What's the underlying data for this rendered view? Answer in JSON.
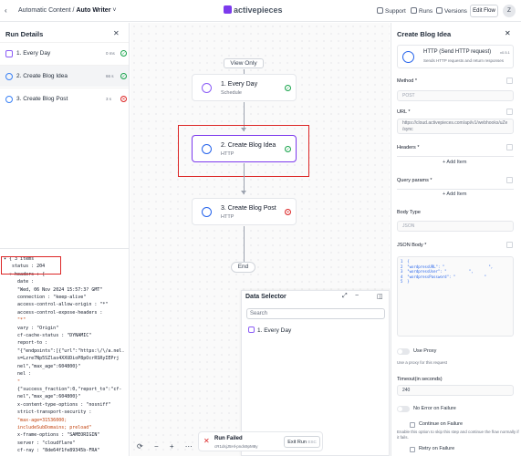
{
  "topbar": {
    "back_icon": "back-arrow",
    "breadcrumb_prefix": "Automatic Content /",
    "breadcrumb_flow": "Auto Writer",
    "brand": "activepieces",
    "support": "Support",
    "runs": "Runs",
    "versions": "Versions",
    "edit_flow": "Edit Flow",
    "avatar": "Z"
  },
  "run_details": {
    "title": "Run Details",
    "steps": [
      {
        "label": "1. Every Day",
        "time": "0 ms",
        "status": "success"
      },
      {
        "label": "2. Create Blog Idea",
        "time": "66 s",
        "status": "success"
      },
      {
        "label": "3. Create Blog Post",
        "time": "3 s",
        "status": "failed"
      }
    ],
    "output_lines": [
      "▾ { 3 items",
      "   status : 204",
      "  ▾ headers : {",
      "     date :",
      "     \"Wed, 06 Nov 2024 15:57:3? GMT\"",
      "     connection : \"keep-alive\"",
      "     access-control-allow-origin : \"*\"",
      "     access-control-expose-headers :",
      "     \"*\"",
      "     vary : \"Origin\"",
      "     cf-cache-status : \"DYNAMIC\"",
      "     report-to :",
      "     \"{\"endpoints\":[{\"url\":\"https:\\/\\/a.nel.",
      "     s=Lzre7Np5SZlas4XXUDioP8pOcrRSRyIEPrj",
      "     nel\",\"max_age\":604800}\"",
      "     nel :",
      "     \"",
      "     {\"success_fraction\":0,\"report_to\":\"cf-",
      "     nel\",\"max_age\":604800}\"",
      "     x-content-type-options : \"nosniff\"",
      "     strict-transport-security :",
      "     \"max-age=31536000;",
      "     includeSubDomains; preload\"",
      "     x-frame-options : \"SAMEORIGIN\"",
      "     server : \"cloudflare\"",
      "     cf-ray : \"8de64f1fe89345b-FRA\""
    ]
  },
  "canvas": {
    "view_only": "View Only",
    "nodes": [
      {
        "title": "1. Every Day",
        "subtitle": "Schedule",
        "status": "success"
      },
      {
        "title": "2. Create Blog Idea",
        "subtitle": "HTTP",
        "status": "success"
      },
      {
        "title": "3. Create Blog Post",
        "subtitle": "HTTP",
        "status": "failed"
      }
    ],
    "end": "End",
    "controls": [
      "⟳",
      "−",
      "+",
      "⋯"
    ]
  },
  "toast": {
    "title": "Run Failed",
    "subtitle": "cR1dsjJ5Hl-pnds9pM8y",
    "exit": "Exit Run",
    "esc": "ESC"
  },
  "data_selector": {
    "title": "Data Selector",
    "search_placeholder": "Search",
    "items": [
      "1. Every Day"
    ]
  },
  "step_settings": {
    "title": "Create Blog Idea",
    "piece_name": "HTTP (Send HTTP request)",
    "piece_version": "v0.5.1",
    "piece_desc": "Sends HTTP requests and return responses",
    "method_label": "Method *",
    "method_value": "POST",
    "url_label": "URL *",
    "url_value": "https://cloud.activepieces.com/api/v1/webhooks/uZe",
    "url_value2": "                                 /sync",
    "headers_label": "Headers *",
    "query_label": "Query params *",
    "add_item": "+ Add Item",
    "body_type_label": "Body Type",
    "body_type_value": "JSON",
    "json_body_label": "JSON Body *",
    "json_lines": [
      "{",
      "\"wordpressURL\": \"                    \",",
      "\"wordpressUser\": \"          \",",
      "\"wordpressPassword\": \"             \"",
      "}"
    ],
    "use_proxy_label": "Use Proxy",
    "use_proxy_hint": "Use a proxy for this request",
    "timeout_label": "Timeout(in seconds)",
    "timeout_value": "240",
    "no_error_label": "No Error on Failure",
    "continue_label": "Continue on Failure",
    "continue_hint1": "Enable this option to skip this step and continue the flow normally if",
    "continue_hint2": "it fails.",
    "retry_label": "Retry on Failure"
  }
}
